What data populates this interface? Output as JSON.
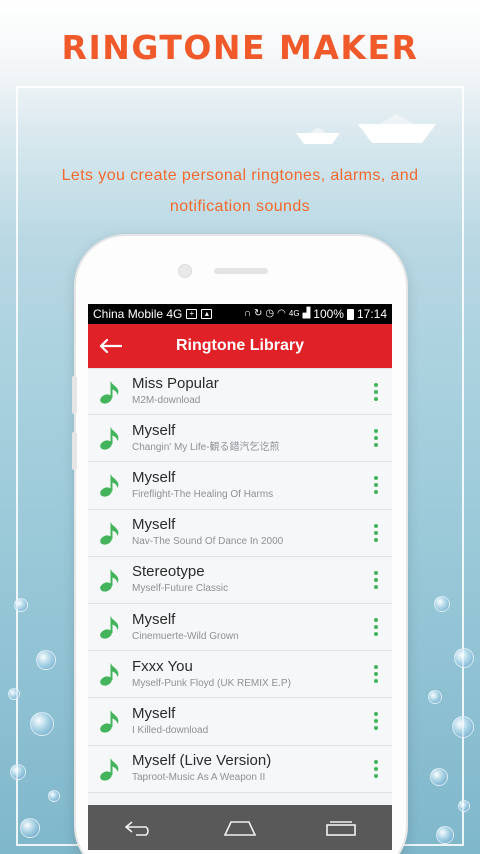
{
  "promo": {
    "title": "Ringtone Maker",
    "subtitle_line1": "Lets you create personal ringtones, alarms, and",
    "subtitle_line2": "notification sounds",
    "accent_color": "#f05a2a"
  },
  "status_bar": {
    "carrier": "China Mobile 4G",
    "network_label": "4G",
    "battery": "100%",
    "time": "17:14"
  },
  "app_bar": {
    "title": "Ringtone Library",
    "back_icon": "arrow-left-icon",
    "color": "#e02127"
  },
  "songs": [
    {
      "title": "Miss Popular",
      "artist": "M2M-download"
    },
    {
      "title": "Myself",
      "artist": "Changin' My Life-観る錯汽乞讫煎"
    },
    {
      "title": "Myself",
      "artist": "Fireflight-The Healing Of Harms"
    },
    {
      "title": "Myself",
      "artist": "Nav-The Sound Of Dance In 2000"
    },
    {
      "title": "Stereotype",
      "artist": "Myself-Future Classic"
    },
    {
      "title": "Myself",
      "artist": "Cinemuerte-Wild Grown"
    },
    {
      "title": "Fxxx You",
      "artist": "Myself-Punk Floyd (UK REMIX E.P)"
    },
    {
      "title": "Myself",
      "artist": "I Killed-download"
    },
    {
      "title": "Myself (Live Version)",
      "artist": "Taproot-Music As A Weapon II"
    }
  ],
  "list_icons": {
    "leading": "music-note-icon",
    "trailing": "more-vert-icon",
    "color": "#43b45b"
  },
  "nav_bar": {
    "icons": [
      "back-icon",
      "home-icon",
      "recents-icon"
    ]
  }
}
